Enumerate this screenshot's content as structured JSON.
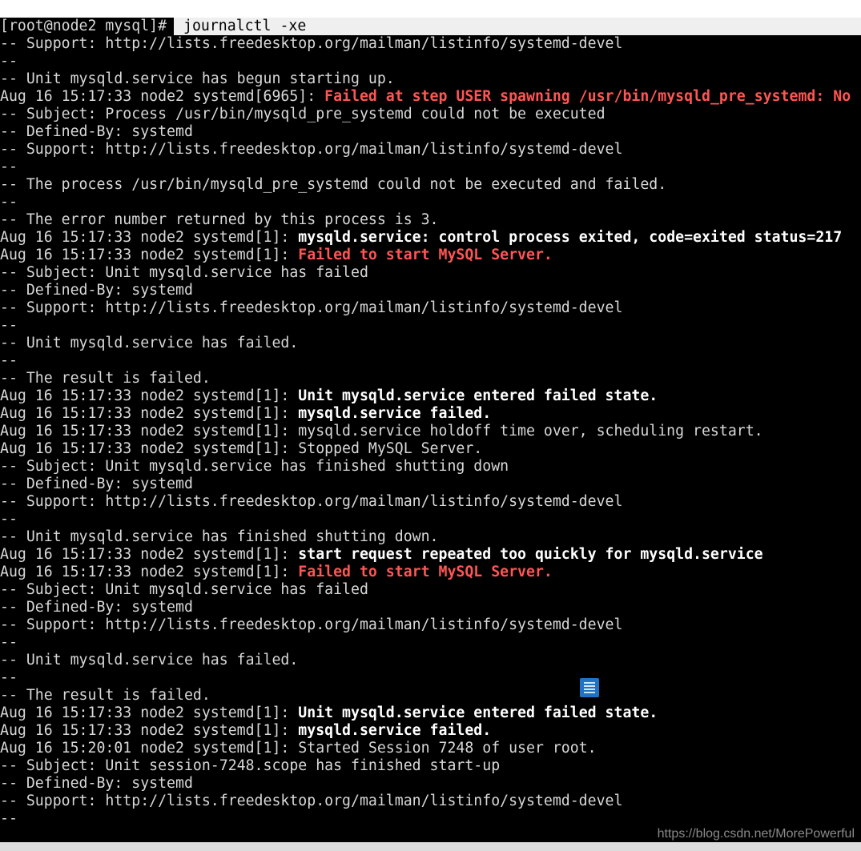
{
  "terminal": {
    "prompt": "[root@node2 mysql]#",
    "command": "journalctl -xe",
    "lines": [
      [
        {
          "t": "-- Support: http://lists.freedesktop.org/mailman/listinfo/systemd-devel"
        }
      ],
      [
        {
          "t": "--"
        }
      ],
      [
        {
          "t": "-- Unit mysqld.service has begun starting up."
        }
      ],
      [
        {
          "t": "Aug 16 15:17:33 node2 systemd[6965]: "
        },
        {
          "t": "Failed at step USER spawning /usr/bin/mysqld_pre_systemd: No",
          "s": "red"
        }
      ],
      [
        {
          "t": "-- Subject: Process /usr/bin/mysqld_pre_systemd could not be executed"
        }
      ],
      [
        {
          "t": "-- Defined-By: systemd"
        }
      ],
      [
        {
          "t": "-- Support: http://lists.freedesktop.org/mailman/listinfo/systemd-devel"
        }
      ],
      [
        {
          "t": "--"
        }
      ],
      [
        {
          "t": "-- The process /usr/bin/mysqld_pre_systemd could not be executed and failed."
        }
      ],
      [
        {
          "t": "--"
        }
      ],
      [
        {
          "t": "-- The error number returned by this process is 3."
        }
      ],
      [
        {
          "t": "Aug 16 15:17:33 node2 systemd[1]: "
        },
        {
          "t": "mysqld.service: control process exited, code=exited status=217",
          "s": "bold"
        }
      ],
      [
        {
          "t": "Aug 16 15:17:33 node2 systemd[1]: "
        },
        {
          "t": "Failed to start MySQL Server.",
          "s": "red"
        }
      ],
      [
        {
          "t": "-- Subject: Unit mysqld.service has failed"
        }
      ],
      [
        {
          "t": "-- Defined-By: systemd"
        }
      ],
      [
        {
          "t": "-- Support: http://lists.freedesktop.org/mailman/listinfo/systemd-devel"
        }
      ],
      [
        {
          "t": "--"
        }
      ],
      [
        {
          "t": "-- Unit mysqld.service has failed."
        }
      ],
      [
        {
          "t": "--"
        }
      ],
      [
        {
          "t": "-- The result is failed."
        }
      ],
      [
        {
          "t": "Aug 16 15:17:33 node2 systemd[1]: "
        },
        {
          "t": "Unit mysqld.service entered failed state.",
          "s": "bold"
        }
      ],
      [
        {
          "t": "Aug 16 15:17:33 node2 systemd[1]: "
        },
        {
          "t": "mysqld.service failed.",
          "s": "bold"
        }
      ],
      [
        {
          "t": "Aug 16 15:17:33 node2 systemd[1]: mysqld.service holdoff time over, scheduling restart."
        }
      ],
      [
        {
          "t": "Aug 16 15:17:33 node2 systemd[1]: Stopped MySQL Server."
        }
      ],
      [
        {
          "t": "-- Subject: Unit mysqld.service has finished shutting down"
        }
      ],
      [
        {
          "t": "-- Defined-By: systemd"
        }
      ],
      [
        {
          "t": "-- Support: http://lists.freedesktop.org/mailman/listinfo/systemd-devel"
        }
      ],
      [
        {
          "t": "--"
        }
      ],
      [
        {
          "t": "-- Unit mysqld.service has finished shutting down."
        }
      ],
      [
        {
          "t": "Aug 16 15:17:33 node2 systemd[1]: "
        },
        {
          "t": "start request repeated too quickly for mysqld.service",
          "s": "bold"
        }
      ],
      [
        {
          "t": "Aug 16 15:17:33 node2 systemd[1]: "
        },
        {
          "t": "Failed to start MySQL Server.",
          "s": "red"
        }
      ],
      [
        {
          "t": "-- Subject: Unit mysqld.service has failed"
        }
      ],
      [
        {
          "t": "-- Defined-By: systemd"
        }
      ],
      [
        {
          "t": "-- Support: http://lists.freedesktop.org/mailman/listinfo/systemd-devel"
        }
      ],
      [
        {
          "t": "--"
        }
      ],
      [
        {
          "t": "-- Unit mysqld.service has failed."
        }
      ],
      [
        {
          "t": "--"
        }
      ],
      [
        {
          "t": "-- The result is failed."
        }
      ],
      [
        {
          "t": "Aug 16 15:17:33 node2 systemd[1]: "
        },
        {
          "t": "Unit mysqld.service entered failed state.",
          "s": "bold"
        }
      ],
      [
        {
          "t": "Aug 16 15:17:33 node2 systemd[1]: "
        },
        {
          "t": "mysqld.service failed.",
          "s": "bold"
        }
      ],
      [
        {
          "t": "Aug 16 15:20:01 node2 systemd[1]: Started Session 7248 of user root."
        }
      ],
      [
        {
          "t": "-- Subject: Unit session-7248.scope has finished start-up"
        }
      ],
      [
        {
          "t": "-- Defined-By: systemd"
        }
      ],
      [
        {
          "t": "-- Support: http://lists.freedesktop.org/mailman/listinfo/systemd-devel"
        }
      ],
      [
        {
          "t": "--"
        }
      ]
    ]
  },
  "overlay": {
    "icon": "document-icon"
  },
  "watermark": "https://blog.csdn.net/MorePowerful",
  "colors": {
    "background": "#000000",
    "text": "#d8d8d8",
    "bold": "#ffffff",
    "error": "#ff5555",
    "command_bg": "#efefef"
  }
}
